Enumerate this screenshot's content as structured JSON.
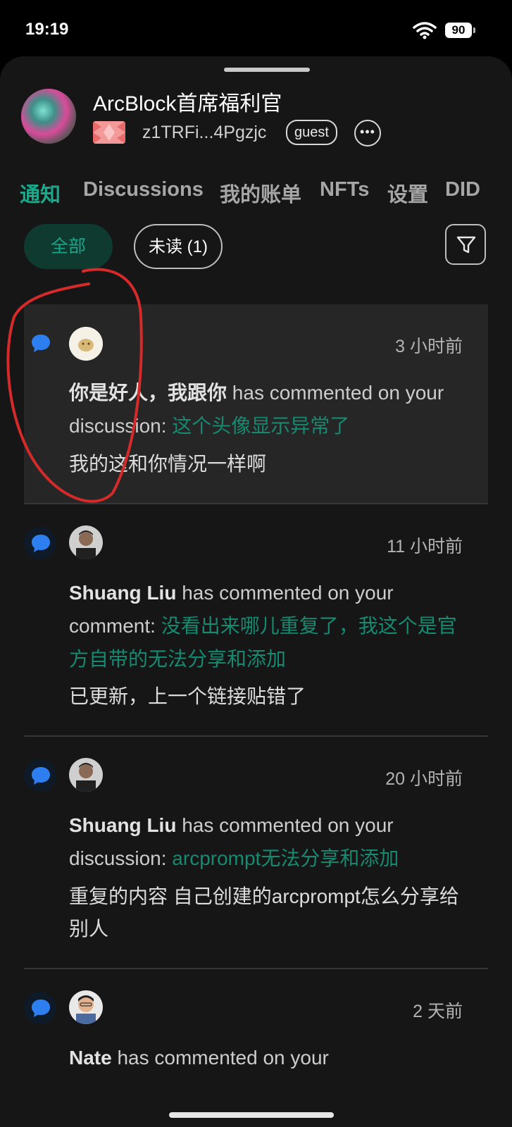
{
  "status_bar": {
    "time": "19:19",
    "battery": "90"
  },
  "profile": {
    "name": "ArcBlock首席福利官",
    "did": "z1TRFi...4Pgzjc",
    "role_badge": "guest"
  },
  "tabs": [
    {
      "label": "通知",
      "active": true
    },
    {
      "label": "Discussions"
    },
    {
      "label": "我的账单"
    },
    {
      "label": "NFTs"
    },
    {
      "label": "设置"
    },
    {
      "label": "DID"
    }
  ],
  "filters": {
    "all_label": "全部",
    "unread_label": "未读 (1)"
  },
  "notifications": [
    {
      "time": "3 小时前",
      "author": "你是好人，我跟你",
      "action": "has commented on your discussion:",
      "link": "这个头像显示异常了",
      "body": "我的这和你情况一样啊",
      "unread": true
    },
    {
      "time": "11 小时前",
      "author": "Shuang Liu",
      "action": "has commented on your comment:",
      "link": "没看出来哪儿重复了，我这个是官方自带的无法分享和添加",
      "body": "已更新，上一个链接贴错了"
    },
    {
      "time": "20 小时前",
      "author": "Shuang Liu",
      "action": "has commented on your discussion:",
      "link": "arcprompt无法分享和添加",
      "body": "重复的内容 自己创建的arcprompt怎么分享给别人"
    },
    {
      "time": "2 天前",
      "author": "Nate",
      "action": "has commented on your"
    }
  ],
  "colors": {
    "accent": "#19a98a",
    "link": "#158a70",
    "annotation": "#d42a2a",
    "message_icon": "#2d7ff0"
  }
}
